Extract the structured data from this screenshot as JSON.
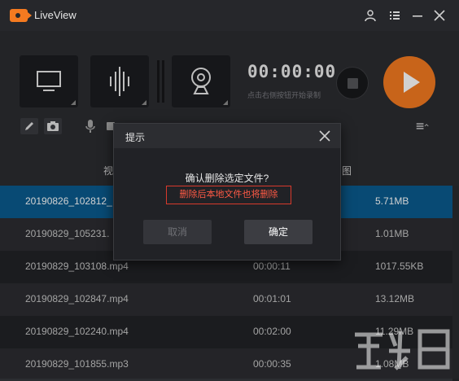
{
  "window": {
    "title": "LiveView"
  },
  "colors": {
    "accent": "#f47a20",
    "selected_row": "#0a5b8e",
    "warning": "#ff5a45"
  },
  "titlebar_icons": [
    "user-icon",
    "list-menu-icon",
    "minimize-icon",
    "close-icon"
  ],
  "recorder": {
    "timer": "00:00:00",
    "hint": "点击右侧按钮开始录制",
    "sources": [
      "screen-icon",
      "audio-wave-icon",
      "webcam-icon"
    ],
    "tools": [
      "pencil-icon",
      "camera-icon",
      "microphone-icon"
    ]
  },
  "table": {
    "headers": [
      "视",
      "图"
    ],
    "rows": [
      {
        "name": "20190826_102812_",
        "duration": "",
        "size": "5.71MB",
        "selected": true
      },
      {
        "name": "20190829_105231.",
        "duration": "",
        "size": "1.01MB",
        "selected": false
      },
      {
        "name": "20190829_103108.mp4",
        "duration": "00:00:11",
        "size": "1017.55KB",
        "selected": false
      },
      {
        "name": "20190829_102847.mp4",
        "duration": "00:01:01",
        "size": "13.12MB",
        "selected": false
      },
      {
        "name": "20190829_102240.mp4",
        "duration": "00:02:00",
        "size": "11.29MB",
        "selected": false
      },
      {
        "name": "20190829_101855.mp3",
        "duration": "00:00:35",
        "size": "1.08MB",
        "selected": false
      }
    ]
  },
  "dialog": {
    "title": "提示",
    "question": "确认删除选定文件?",
    "warning": "删除后本地文件也将删除",
    "cancel_label": "取消",
    "ok_label": "确定"
  }
}
